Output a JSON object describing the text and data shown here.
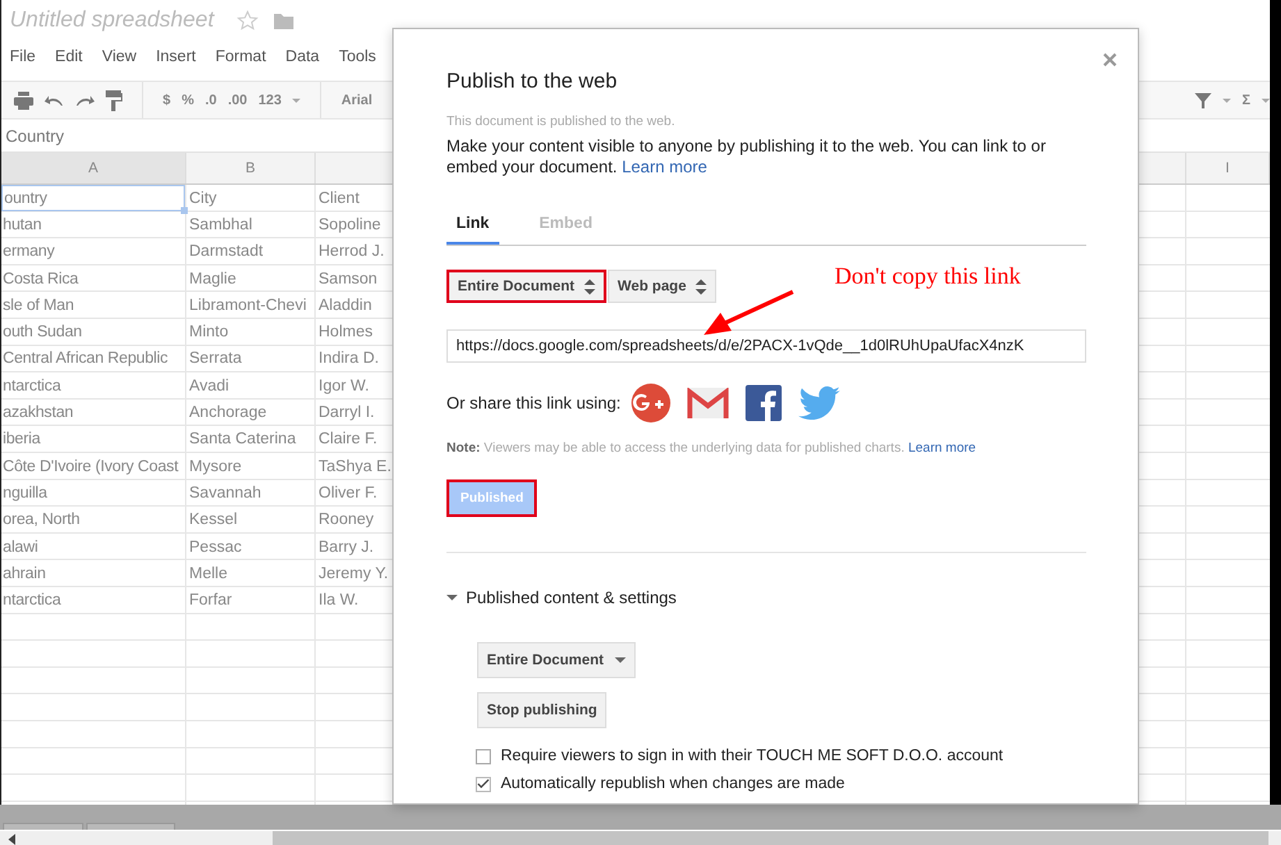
{
  "spreadsheet": {
    "title": "Untitled spreadsheet",
    "menu": [
      "File",
      "Edit",
      "View",
      "Insert",
      "Format",
      "Data",
      "Tools"
    ],
    "toolbar": {
      "currency": "$",
      "percent": "%",
      "decrease_decimals": ".0",
      "increase_decimals": ".00",
      "number_format": "123",
      "font": "Arial",
      "functions": "Σ"
    },
    "formula": "Country",
    "column_headers": [
      "A",
      "B",
      "I"
    ],
    "rows": [
      {
        "cells": [
          "ountry",
          "City",
          "Client"
        ],
        "selected": true
      },
      {
        "cells": [
          "hutan",
          "Sambhal",
          "Sopoline"
        ],
        "selected": false
      },
      {
        "cells": [
          "ermany",
          "Darmstadt",
          "Herrod J."
        ],
        "selected": false
      },
      {
        "cells": [
          "Costa Rica",
          "Maglie",
          "Samson"
        ],
        "selected": false
      },
      {
        "cells": [
          "sle of Man",
          "Libramont-Chevi",
          "Aladdin"
        ],
        "selected": false
      },
      {
        "cells": [
          "outh Sudan",
          "Minto",
          "Holmes"
        ],
        "selected": false
      },
      {
        "cells": [
          "Central African Republic",
          "Serrata",
          "Indira D."
        ],
        "selected": false
      },
      {
        "cells": [
          "ntarctica",
          "Avadi",
          "Igor W."
        ],
        "selected": false
      },
      {
        "cells": [
          "azakhstan",
          "Anchorage",
          "Darryl I."
        ],
        "selected": false
      },
      {
        "cells": [
          "iberia",
          "Santa Caterina",
          "Claire F."
        ],
        "selected": false
      },
      {
        "cells": [
          "Côte D'Ivoire (Ivory Coast",
          "Mysore",
          "TaShya E."
        ],
        "selected": false
      },
      {
        "cells": [
          "nguilla",
          "Savannah",
          "Oliver F."
        ],
        "selected": false
      },
      {
        "cells": [
          "orea, North",
          "Kessel",
          "Rooney"
        ],
        "selected": false
      },
      {
        "cells": [
          "alawi",
          "Pessac",
          "Barry J."
        ],
        "selected": false
      },
      {
        "cells": [
          "ahrain",
          "Melle",
          "Jeremy Y."
        ],
        "selected": false
      },
      {
        "cells": [
          "ntarctica",
          "Forfar",
          "Ila W."
        ],
        "selected": false
      }
    ]
  },
  "dialog": {
    "title": "Publish to the web",
    "status": "This document is published to the web.",
    "intro": "Make your content visible to anyone by publishing it to the web. You can link to or embed your document.",
    "intro_link": "Learn more",
    "tabs": [
      {
        "label": "Link",
        "selected": true
      },
      {
        "label": "Embed",
        "selected": false
      }
    ],
    "selects": [
      {
        "value": "Entire Document",
        "highlighted": true
      },
      {
        "value": "Web page",
        "highlighted": false
      }
    ],
    "annotation": "Don't copy this link",
    "link_url": "https://docs.google.com/spreadsheets/d/e/2PACX-1vQde__1d0lRUhUpaUfacX4nzK",
    "share_label": "Or share this link using:",
    "note": "**Note:** Viewers may be able to access the underlying data for published charts.",
    "note_link": "Learn more",
    "publish_button": {
      "label": "Published",
      "disabled": true,
      "highlighted": true
    },
    "settings": {
      "label": "Published content & settings",
      "expanded": true,
      "scope": "Entire Document",
      "stop_button": "Stop publishing",
      "options": [
        {
          "label": "Require viewers to sign in with their TOUCH ME SOFT D.O.O. account",
          "checked": false
        },
        {
          "label": "Automatically republish when changes are made",
          "checked": true
        }
      ]
    }
  }
}
